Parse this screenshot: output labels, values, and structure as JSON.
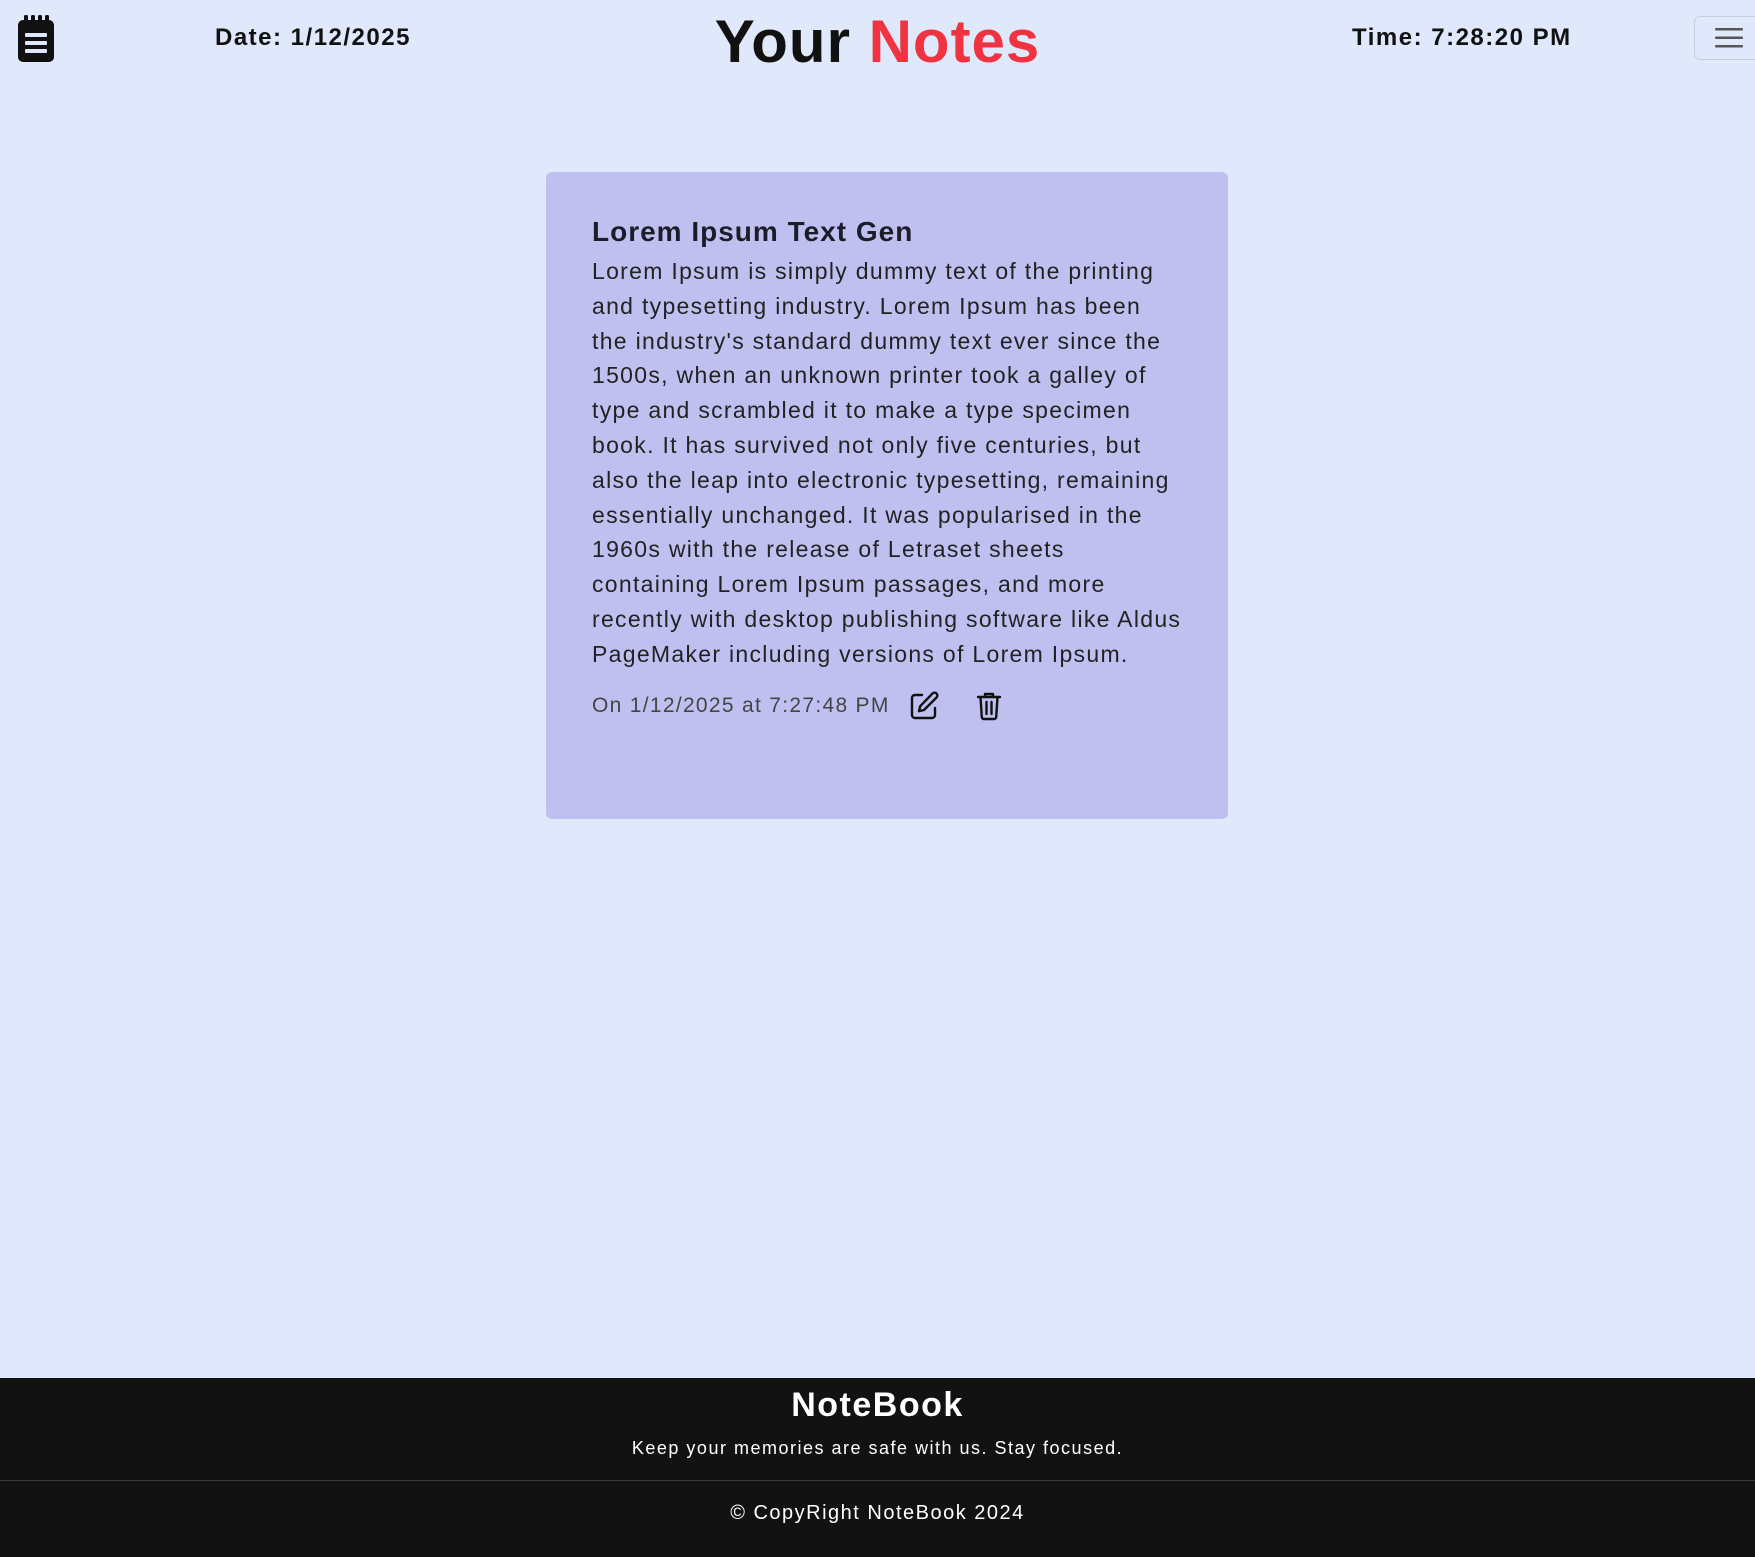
{
  "header": {
    "logo_icon": "notepad-icon",
    "date_text": "Date: 1/12/2025",
    "title_part1": "Your",
    "title_part2": "Notes",
    "time_text": "Time: 7:28:20 PM",
    "menu_icon": "hamburger-menu-icon"
  },
  "colors": {
    "page_background": "#e0e8fb",
    "title_accent": "#ef3340",
    "card_background": "#bfc0f0",
    "footer_background": "#121212"
  },
  "notes": [
    {
      "title": "Lorem Ipsum Text Gen",
      "body": "Lorem Ipsum is simply dummy text of the printing and typesetting industry. Lorem Ipsum has been the industry's standard dummy text ever since the 1500s, when an unknown printer took a galley of type and scrambled it to make a type specimen book. It has survived not only five centuries, but also the leap into electronic typesetting, remaining essentially unchanged. It was popularised in the 1960s with the release of Letraset sheets containing Lorem Ipsum passages, and more recently with desktop publishing software like Aldus PageMaker including versions of Lorem Ipsum.",
      "timestamp": "On 1/12/2025 at 7:27:48 PM",
      "edit_icon": "edit-icon",
      "delete_icon": "trash-icon"
    }
  ],
  "footer": {
    "brand": "NoteBook",
    "tagline": "Keep your memories are safe with us. Stay focused.",
    "copyright": "© CopyRight NoteBook 2024"
  }
}
